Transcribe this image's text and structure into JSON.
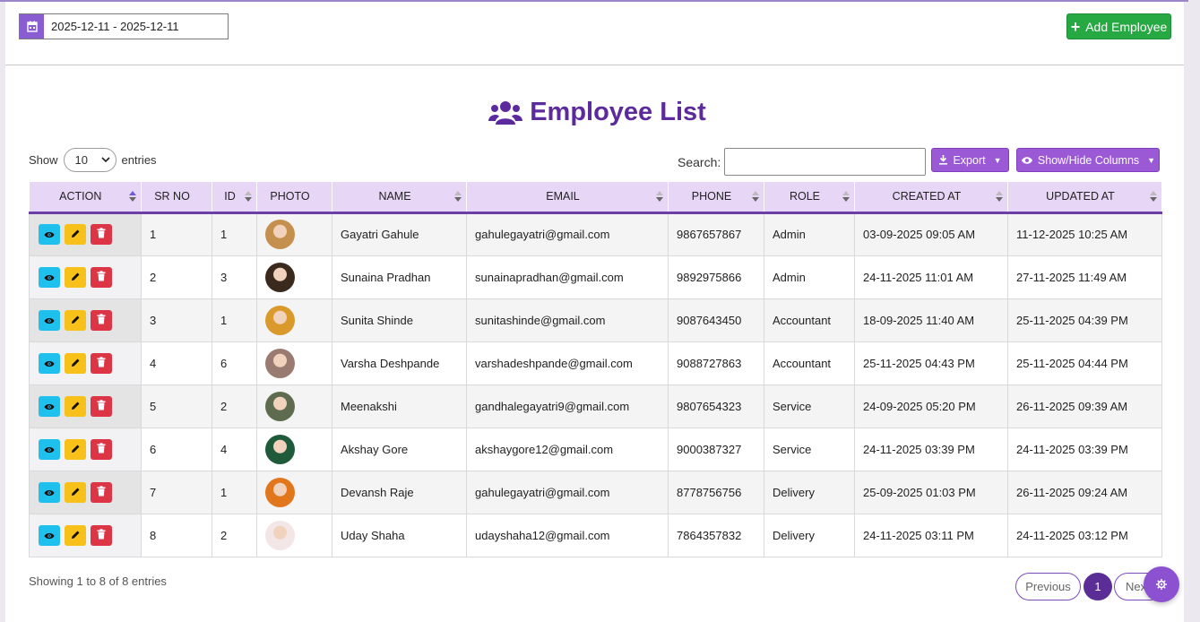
{
  "date_range": "2025-12-11 - 2025-12-11",
  "add_button_label": "Add Employee",
  "title": "Employee List",
  "length": {
    "show_label": "Show",
    "value": "10",
    "entries_label": "entries"
  },
  "search": {
    "label": "Search:",
    "placeholder": ""
  },
  "export_label": "Export",
  "columns_label": "Show/Hide Columns",
  "headers": [
    "ACTION",
    "SR NO",
    "ID",
    "PHOTO",
    "NAME",
    "EMAIL",
    "PHONE",
    "ROLE",
    "CREATED AT",
    "UPDATED AT"
  ],
  "rows": [
    {
      "sr": "1",
      "id": "1",
      "name": "Gayatri Gahule",
      "email": "gahulegayatri@gmail.com",
      "phone": "9867657867",
      "role": "Admin",
      "created": "03-09-2025 09:05 AM",
      "updated": "11-12-2025 10:25 AM",
      "avatar_color": "#c58f4e"
    },
    {
      "sr": "2",
      "id": "3",
      "name": "Sunaina Pradhan",
      "email": "sunainapradhan@gmail.com",
      "phone": "9892975866",
      "role": "Admin",
      "created": "24-11-2025 11:01 AM",
      "updated": "27-11-2025 11:49 AM",
      "avatar_color": "#3a2a1e"
    },
    {
      "sr": "3",
      "id": "1",
      "name": "Sunita Shinde",
      "email": "sunitashinde@gmail.com",
      "phone": "9087643450",
      "role": "Accountant",
      "created": "18-09-2025 11:40 AM",
      "updated": "25-11-2025 04:39 PM",
      "avatar_color": "#d99a2b"
    },
    {
      "sr": "4",
      "id": "6",
      "name": "Varsha Deshpande",
      "email": "varshadeshpande@gmail.com",
      "phone": "9088727863",
      "role": "Accountant",
      "created": "25-11-2025 04:43 PM",
      "updated": "25-11-2025 04:44 PM",
      "avatar_color": "#9a7b72"
    },
    {
      "sr": "5",
      "id": "2",
      "name": "Meenakshi",
      "email": "gandhalegayatri9@gmail.com",
      "phone": "9807654323",
      "role": "Service",
      "created": "24-09-2025 05:20 PM",
      "updated": "26-11-2025 09:39 AM",
      "avatar_color": "#5e6b4e"
    },
    {
      "sr": "6",
      "id": "4",
      "name": "Akshay Gore",
      "email": "akshaygore12@gmail.com",
      "phone": "9000387327",
      "role": "Service",
      "created": "24-11-2025 03:39 PM",
      "updated": "24-11-2025 03:39 PM",
      "avatar_color": "#1f5a3a"
    },
    {
      "sr": "7",
      "id": "1",
      "name": "Devansh Raje",
      "email": "gahulegayatri@gmail.com",
      "phone": "8778756756",
      "role": "Delivery",
      "created": "25-09-2025 01:03 PM",
      "updated": "26-11-2025 09:24 AM",
      "avatar_color": "#e2761c"
    },
    {
      "sr": "8",
      "id": "2",
      "name": "Uday Shaha",
      "email": "udayshaha12@gmail.com",
      "phone": "7864357832",
      "role": "Delivery",
      "created": "24-11-2025 03:11 PM",
      "updated": "24-11-2025 03:12 PM",
      "avatar_color": "#f3e6e6"
    }
  ],
  "footer_info": "Showing 1 to 8 of 8 entries",
  "pagination": {
    "previous": "Previous",
    "current": "1",
    "next": "Next"
  }
}
